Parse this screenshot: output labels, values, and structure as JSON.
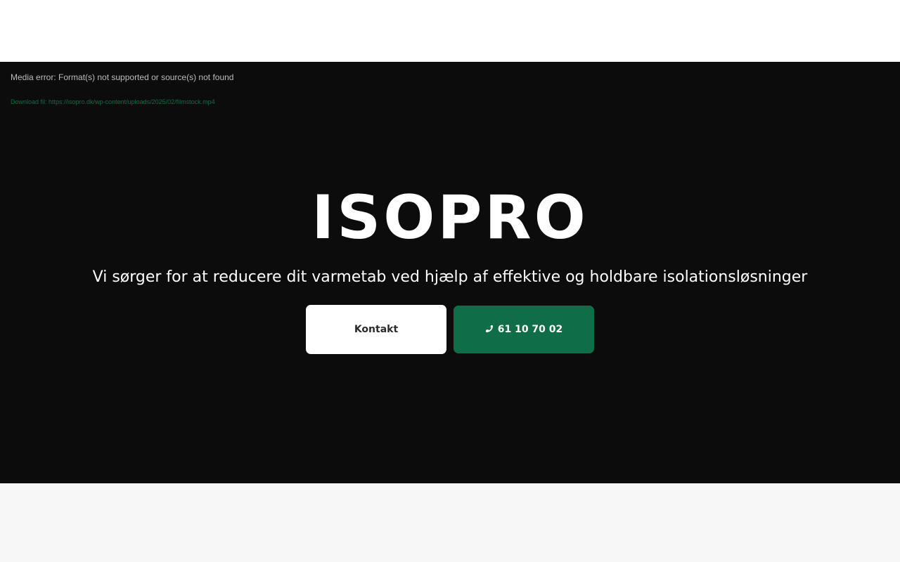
{
  "media_error": {
    "message": "Media error: Format(s) not supported or source(s) not found",
    "download_link": "Download fil: https://isopro.dk/wp-content/uploads/2025/02/filmstock.mp4"
  },
  "hero": {
    "brand": "ISOPRO",
    "tagline": "Vi sørger for at reducere dit varmetab ved hjælp af effektive og holdbare isolationsløsninger",
    "contact_button_label": "Kontakt",
    "phone_button_label": "61 10 70 02",
    "phone_icon": "phone-icon"
  },
  "colors": {
    "hero_background": "#0c0c0c",
    "accent_green": "#0f6e47",
    "header_background": "#ffffff",
    "page_background": "#f7f7f7"
  }
}
